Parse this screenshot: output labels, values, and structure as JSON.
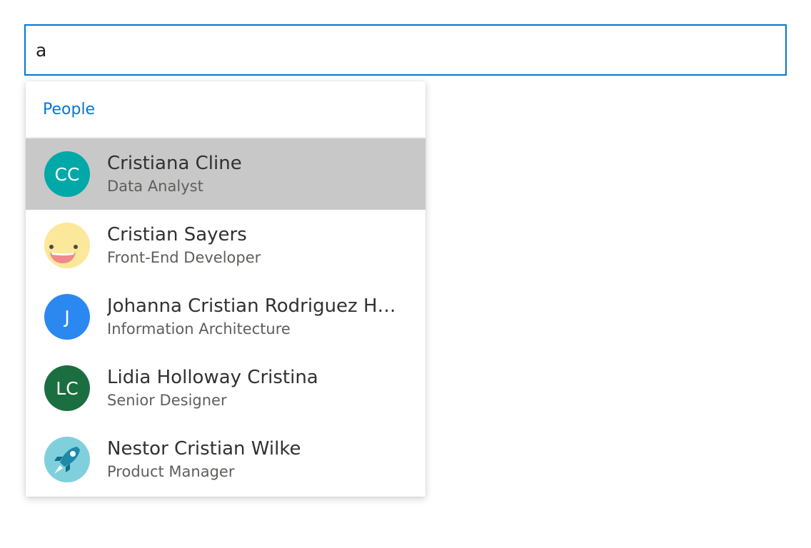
{
  "search": {
    "value": "a"
  },
  "suggestions": {
    "header": "People",
    "items": [
      {
        "name": "Cristiana Cline",
        "title": "Data Analyst",
        "initials": "CC",
        "avatar_color": "#00a8a8",
        "avatar_type": "initials",
        "selected": true
      },
      {
        "name": "Cristian Sayers",
        "title": "Front-End Developer",
        "initials": "",
        "avatar_color": "#fbe89a",
        "avatar_type": "smiley-face-icon",
        "selected": false
      },
      {
        "name": "Johanna Cristian Rodriguez Hern...",
        "title": "Information Architecture",
        "initials": "J",
        "avatar_color": "#2b88f0",
        "avatar_type": "initials",
        "selected": false
      },
      {
        "name": "Lidia Holloway Cristina",
        "title": "Senior Designer",
        "initials": "LC",
        "avatar_color": "#1b6e3f",
        "avatar_type": "initials",
        "selected": false
      },
      {
        "name": "Nestor Cristian Wilke",
        "title": "Product Manager",
        "initials": "",
        "avatar_color": "#7fd0dc",
        "avatar_type": "rocket-icon",
        "selected": false
      }
    ]
  },
  "colors": {
    "accent": "#0078d4",
    "selected_bg": "#c8c8c8"
  }
}
